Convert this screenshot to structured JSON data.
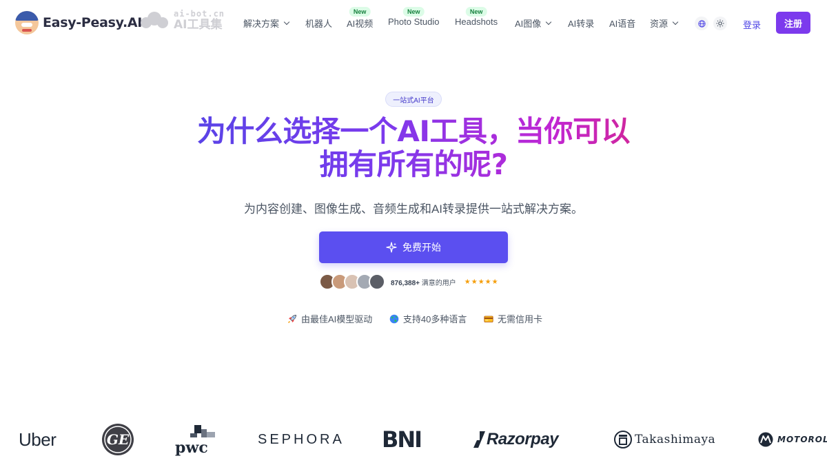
{
  "nav": {
    "brand": "Easy-Peasy.AI",
    "partner_domain": "ai-bot.cn",
    "partner_name": "AI工具集",
    "items": [
      {
        "label": "解决方案",
        "dropdown": true,
        "badge": ""
      },
      {
        "label": "机器人",
        "dropdown": false,
        "badge": ""
      },
      {
        "label": "AI视频",
        "dropdown": false,
        "badge": "New"
      },
      {
        "label": "Photo Studio",
        "dropdown": false,
        "badge": "New"
      },
      {
        "label": "Headshots",
        "dropdown": false,
        "badge": "New"
      },
      {
        "label": "AI图像",
        "dropdown": true,
        "badge": ""
      },
      {
        "label": "AI转录",
        "dropdown": false,
        "badge": ""
      },
      {
        "label": "AI语音",
        "dropdown": false,
        "badge": ""
      },
      {
        "label": "资源",
        "dropdown": true,
        "badge": ""
      }
    ],
    "icons": [
      "globe-icon",
      "sun-icon"
    ],
    "login": "登录",
    "signup": "注册"
  },
  "hero": {
    "pill": "一站式AI平台",
    "headline_line1": "为什么选择一个AI工具，当你可以",
    "headline_line2": "拥有所有的呢?",
    "subline": "为内容创建、图像生成、音频生成和AI转录提供一站式解决方案。",
    "cta": "免费开始",
    "users_count": "876,388+",
    "users_label": "满意的用户",
    "rating_stars": 5,
    "stars_text": "★★★★★",
    "features": [
      {
        "icon": "rocket-icon",
        "label": "由最佳AI模型驱动"
      },
      {
        "icon": "globe-icon",
        "label": "支持40多种语言"
      },
      {
        "icon": "credit-card-icon",
        "label": "无需信用卡"
      }
    ]
  },
  "brands": [
    {
      "name": "Uber"
    },
    {
      "name": "GE"
    },
    {
      "name": "pwc"
    },
    {
      "name": "SEPHORA"
    },
    {
      "name": "BNI"
    },
    {
      "name": "Razorpay"
    },
    {
      "name": "Takashimaya"
    },
    {
      "name": "MOTOROLA"
    }
  ],
  "colors": {
    "accent": "#5b4ff0",
    "signup_bg": "#7c3aed",
    "gradient_start": "#4f46e5",
    "gradient_end": "#db2777",
    "new_badge_bg": "#dcfce7",
    "new_badge_text": "#15803d",
    "star": "#f59e0b"
  }
}
